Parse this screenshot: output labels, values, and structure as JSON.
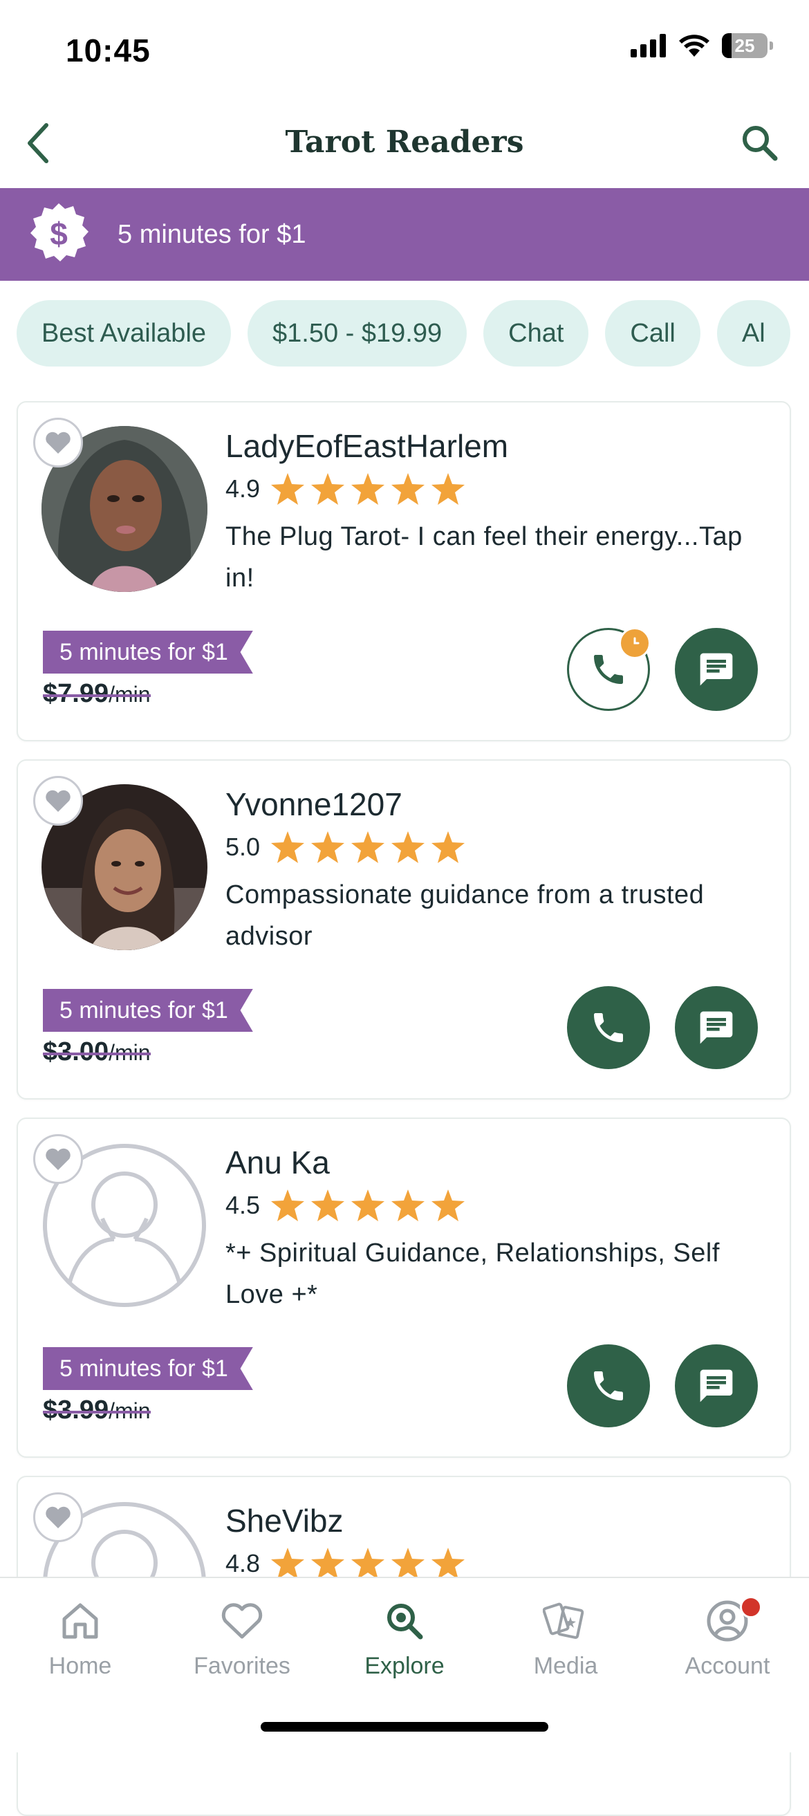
{
  "status_bar": {
    "time": "10:45",
    "battery": "25"
  },
  "header": {
    "title": "Tarot Readers"
  },
  "promo_banner": {
    "text": "5 minutes for $1"
  },
  "filters": [
    "Best Available",
    "$1.50 - $19.99",
    "Chat",
    "Call",
    "Al"
  ],
  "readers": [
    {
      "name": "LadyEofEastHarlem",
      "rating": "4.9",
      "stars": 5,
      "description": "The Plug Tarot- I can feel their energy...Tap in!",
      "promo": "5 minutes for $1",
      "old_price": "$7.99",
      "per": "/min",
      "call_state": "busy"
    },
    {
      "name": "Yvonne1207",
      "rating": "5.0",
      "stars": 5,
      "description": "Compassionate guidance from a trusted advisor",
      "promo": "5 minutes for $1",
      "old_price": "$3.00",
      "per": "/min",
      "call_state": "available"
    },
    {
      "name": "Anu Ka",
      "rating": "4.5",
      "stars": 5,
      "description": "*+ Spiritual Guidance, Relationships, Self Love +*",
      "promo": "5 minutes for $1",
      "old_price": "$3.99",
      "per": "/min",
      "call_state": "available"
    },
    {
      "name": "SheVibz",
      "rating": "4.8",
      "stars": 5
    }
  ],
  "tabs": [
    {
      "label": "Home",
      "icon": "home-icon"
    },
    {
      "label": "Favorites",
      "icon": "heart-icon"
    },
    {
      "label": "Explore",
      "icon": "search-icon",
      "active": true
    },
    {
      "label": "Media",
      "icon": "cards-icon"
    },
    {
      "label": "Account",
      "icon": "account-icon"
    }
  ],
  "colors": {
    "brand_purple": "#8a5ca6",
    "brand_green": "#2f6148",
    "star": "#f2a33a",
    "chip_bg": "#dff2ef"
  }
}
